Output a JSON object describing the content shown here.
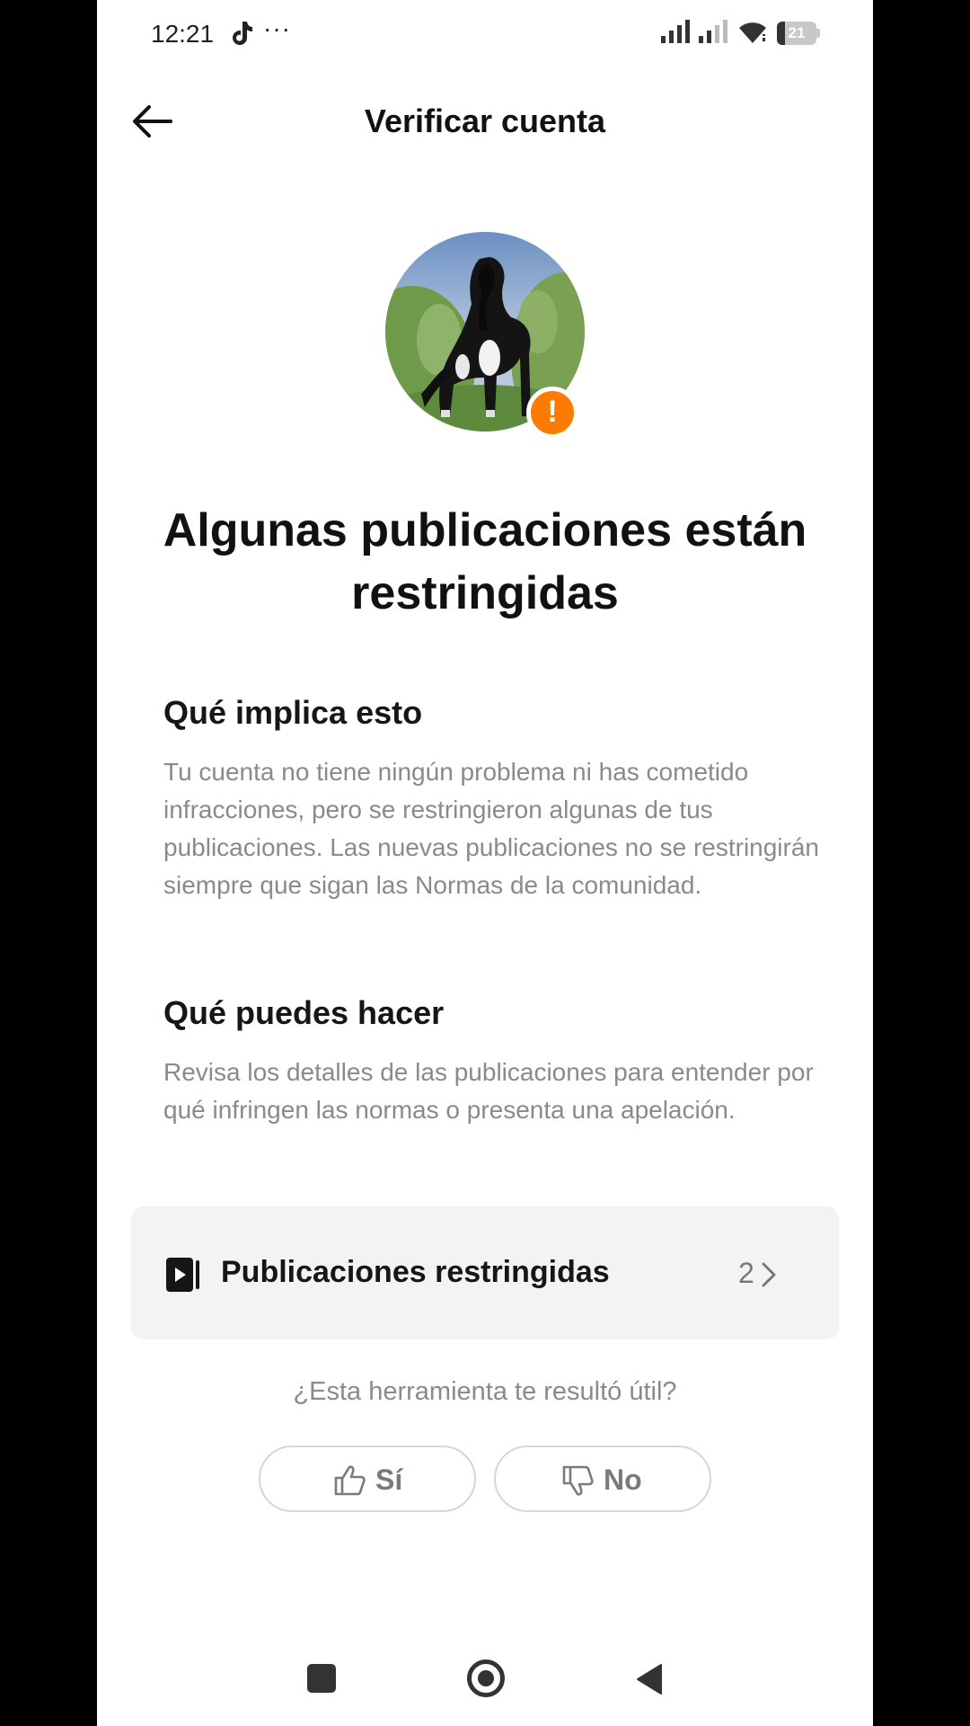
{
  "status_bar": {
    "time": "12:21",
    "overflow": "···",
    "app_icon": "tiktok-icon",
    "signal_icons": [
      "signal-icon",
      "signal-icon"
    ],
    "wifi_icon": "wifi-icon",
    "battery_level": "21",
    "battery_fraction": 0.21
  },
  "header": {
    "back_icon": "arrow-left-icon",
    "title": "Verificar cuenta"
  },
  "profile": {
    "avatar": "horse-photo",
    "badge_icon": "exclamation-icon",
    "badge_mark": "!",
    "badge_color": "#ff7a00"
  },
  "main": {
    "heading": "Algunas publicaciones están restringidas",
    "sections": [
      {
        "title": "Qué implica esto",
        "body": "Tu cuenta no tiene ningún problema ni has cometido infracciones, pero se restringieron algunas de tus publicaciones. Las nuevas publicaciones no se restringirán siempre que sigan las Normas de la comunidad."
      },
      {
        "title": "Qué puedes hacer",
        "body": "Revisa los detalles de las publicaciones para entender por qué infringen las normas o presenta una apelación."
      }
    ],
    "restricted_posts": {
      "icon": "video-play-icon",
      "label": "Publicaciones restringidas",
      "count": "2"
    }
  },
  "feedback": {
    "question": "¿Esta herramienta te resultó útil?",
    "yes_label": "Sí",
    "no_label": "No",
    "yes_icon": "thumbs-up-icon",
    "no_icon": "thumbs-down-icon"
  },
  "nav_bar": {
    "icons": [
      "recents-square-icon",
      "home-circle-icon",
      "back-triangle-icon"
    ]
  }
}
